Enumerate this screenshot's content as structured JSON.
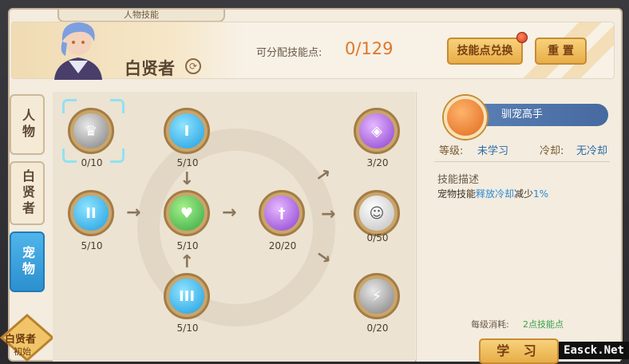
{
  "window": {
    "title": "人物技能"
  },
  "header": {
    "character_name": "白贤者",
    "points_label": "可分配技能点:",
    "points_value": "0/129",
    "exchange_button": "技能点兑换",
    "reset_button": "重 置"
  },
  "sidebar": {
    "tabs": [
      {
        "label": "人物",
        "active": false
      },
      {
        "label": "白贤者",
        "active": false
      },
      {
        "label": "宠物",
        "active": true
      }
    ],
    "badge_title": "白贤者",
    "badge_sub": "初始"
  },
  "tree": {
    "nodes": [
      {
        "id": "pet-gray-crown",
        "count": "0/10",
        "color": "gray",
        "glyph": "♛"
      },
      {
        "id": "blue-i",
        "count": "5/10",
        "color": "blue",
        "glyph": "I"
      },
      {
        "id": "blue-ii",
        "count": "5/10",
        "color": "blue",
        "glyph": "II"
      },
      {
        "id": "green-heart",
        "count": "5/10",
        "color": "green",
        "glyph": "♥"
      },
      {
        "id": "blue-iii",
        "count": "5/10",
        "color": "blue",
        "glyph": "III"
      },
      {
        "id": "purple-sword",
        "count": "20/20",
        "color": "purple",
        "glyph": "†"
      },
      {
        "id": "purple-shield",
        "count": "3/20",
        "color": "purple",
        "glyph": "◈"
      },
      {
        "id": "white-beast",
        "count": "0/50",
        "color": "grayw",
        "glyph": "☺"
      },
      {
        "id": "gray-bolt-shield",
        "count": "0/20",
        "color": "gray",
        "glyph": "⚡"
      }
    ]
  },
  "detail": {
    "skill_name": "驯宠高手",
    "level_label": "等级:",
    "level_value": "未学习",
    "cooldown_label": "冷却:",
    "cooldown_value": "无冷却",
    "desc_title": "技能描述",
    "desc_pre": "宠物技能",
    "desc_highlight": "释放冷却",
    "desc_mid": "减少",
    "desc_pct": "1%",
    "cost_label": "每级消耗:",
    "cost_value": "2点技能点",
    "learn_button": "学 习"
  },
  "watermark": "Easck.Net",
  "colors": {
    "accent_blue": "#2c8fcf",
    "points_orange": "#e0772a",
    "button_gold": "#e8ad48"
  }
}
